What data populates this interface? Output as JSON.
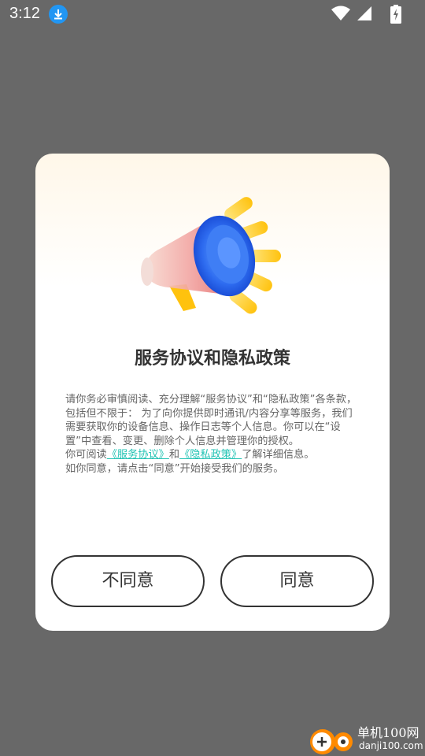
{
  "status_bar": {
    "time": "3:12",
    "icons": [
      "download-notification-icon",
      "wifi-icon",
      "cellular-signal-icon",
      "battery-charging-icon"
    ]
  },
  "dialog": {
    "title": "服务协议和隐私政策",
    "paragraph1": "请你务必审慎阅读、充分理解“服务协议”和“隐私政策”各条款，包括但不限于： 为了向你提供即时通讯/内容分享等服务，我们需要获取你的设备信息、操作日志等个人信息。你可以在“设置”中查看、变更、删除个人信息并管理你的授权。",
    "p2_prefix": "你可阅读",
    "service_link": "《服务协议》",
    "p2_and": "和",
    "privacy_link": "《隐私政策》",
    "p2_suffix": "了解详细信息。",
    "paragraph3": "如你同意，请点击“同意”开始接受我们的服务。",
    "disagree_label": "不同意",
    "agree_label": "同意"
  },
  "watermark": {
    "name": "单机100网",
    "url": "danji100.com"
  },
  "colors": {
    "overlay": "#686868",
    "link": "#22c3b4",
    "text": "#333333",
    "body_text": "#666666"
  }
}
